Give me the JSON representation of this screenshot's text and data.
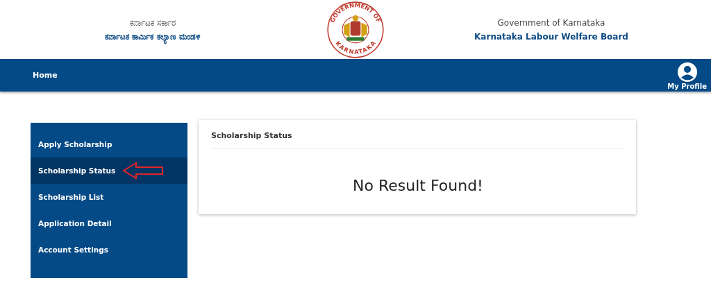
{
  "header": {
    "left_line1": "ಕರ್ನಾಟಕ ಸರ್ಕಾರ",
    "left_line2": "ಕರ್ನಾಟಕ ಕಾರ್ಮಿಕ ಕಲ್ಯಾಣ ಮಂಡಳಿ",
    "seal_top": "GOVERNMENT OF",
    "seal_bottom": "KARNATAKA",
    "right_line1": "Government of Karnataka",
    "right_line2": "Karnataka Labour Welfare Board"
  },
  "nav": {
    "home": "Home",
    "profile": "My Profile"
  },
  "sidebar": {
    "items": [
      {
        "label": "Apply Scholarship",
        "selected": false
      },
      {
        "label": "Scholarship Status",
        "selected": true
      },
      {
        "label": "Scholarship List",
        "selected": false
      },
      {
        "label": "Application Detail",
        "selected": false
      },
      {
        "label": "Account Settings",
        "selected": false
      }
    ]
  },
  "card": {
    "title": "Scholarship Status",
    "message": "No Result Found!"
  }
}
